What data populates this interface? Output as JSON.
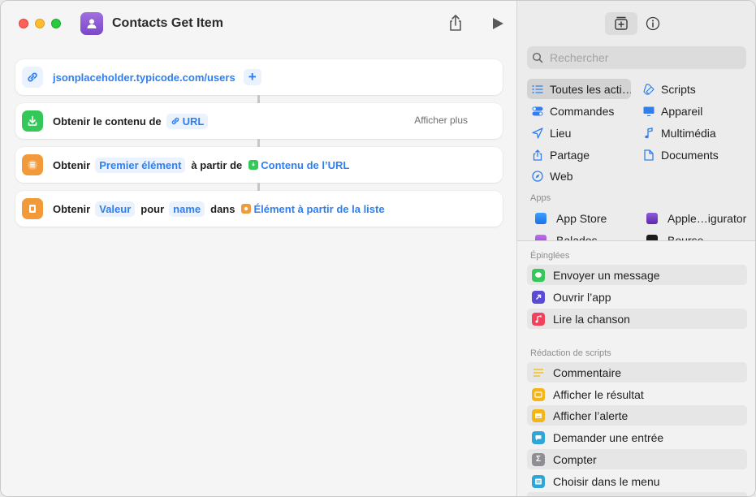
{
  "window": {
    "title": "Contacts Get Item"
  },
  "actions": [
    {
      "url": "jsonplaceholder.typicode.com/users",
      "plus": "+"
    },
    {
      "text": "Obtenir le contenu de",
      "token": "URL",
      "more": "Afficher plus"
    },
    {
      "text1": "Obtenir",
      "token1": "Premier élément",
      "text2": "à partir de",
      "token2": "Contenu de l’URL"
    },
    {
      "text1": "Obtenir",
      "token1": "Valeur",
      "text2": "pour",
      "token2": "name",
      "text3": "dans",
      "token3": "Élément à partir de la liste"
    }
  ],
  "sidebar": {
    "search_placeholder": "Rechercher",
    "categories_left": [
      "Toutes les acti…",
      "Commandes",
      "Lieu",
      "Partage",
      "Web"
    ],
    "categories_right": [
      "Scripts",
      "Appareil",
      "Multimédia",
      "Documents"
    ],
    "apps_label": "Apps",
    "apps": [
      "App Store",
      "Apple…igurator",
      "Balados",
      "Bourse"
    ],
    "pinned_label": "Épinglées",
    "pinned": [
      "Envoyer un message",
      "Ouvrir l’app",
      "Lire la chanson"
    ],
    "scripting_label": "Rédaction de scripts",
    "scripting": [
      "Commentaire",
      "Afficher le résultat",
      "Afficher l’alerte",
      "Demander une entrée",
      "Compter",
      "Choisir dans le menu"
    ]
  },
  "colors": {
    "accent": "#2f7ff0",
    "green": "#34c759",
    "orange": "#f29a3a",
    "purple": "#8a5cd6"
  }
}
